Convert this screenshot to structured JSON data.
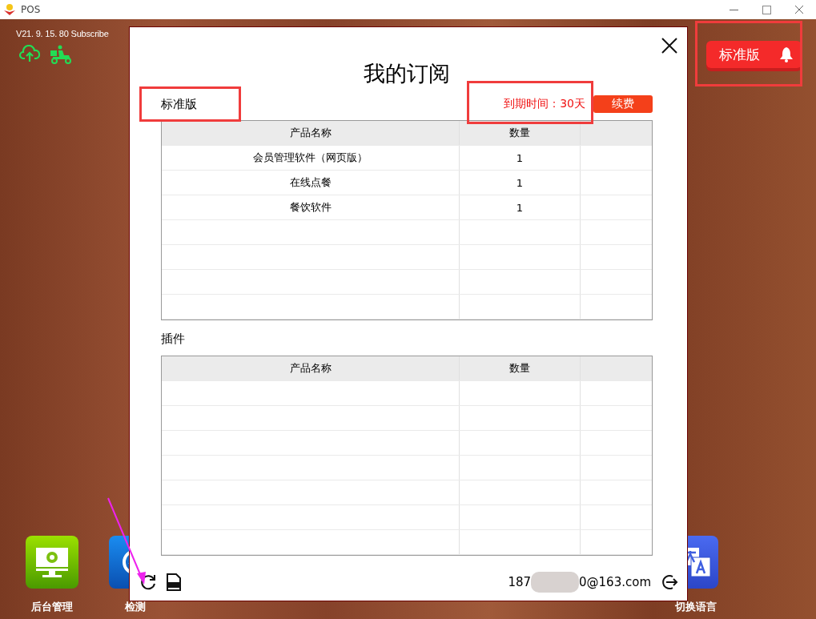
{
  "window": {
    "title": "POS"
  },
  "version": "V21. 9. 15. 80 Subscribe",
  "plan_badge": "标准版",
  "dialog": {
    "title": "我的订阅",
    "plan": "标准版",
    "expiry": "到期时间：30天",
    "renew_button": "续费",
    "subscription_table": {
      "columns": [
        "产品名称",
        "数量"
      ],
      "rows": [
        [
          "会员管理软件（网页版）",
          "1"
        ],
        [
          "在线点餐",
          "1"
        ],
        [
          "餐饮软件",
          "1"
        ]
      ]
    },
    "plugins_heading": "插件",
    "plugins_table": {
      "columns": [
        "产品名称",
        "数量"
      ]
    },
    "account_start": "187",
    "account_end": "0@163.com"
  },
  "apps": [
    {
      "label": "后台管理",
      "kind": "admin"
    },
    {
      "label": "检测",
      "kind": "check"
    },
    {
      "label": "切换语言",
      "kind": "language"
    }
  ]
}
